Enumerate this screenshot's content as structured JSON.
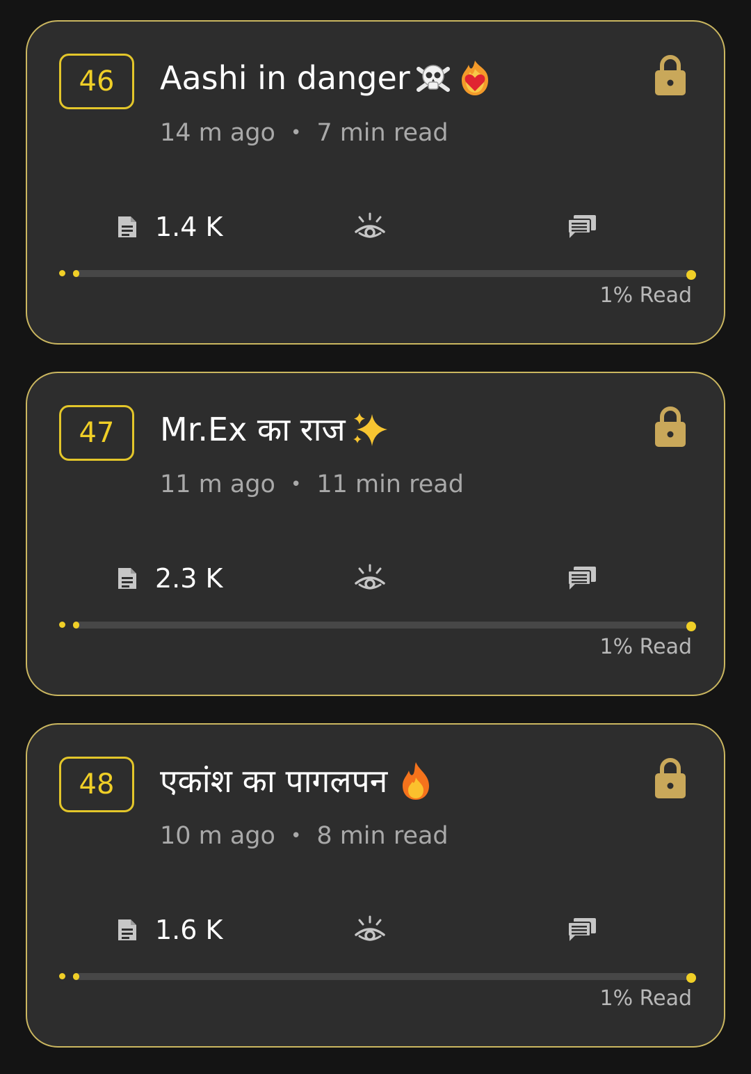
{
  "theme": {
    "background": "#141414",
    "card_background": "#2d2d2d",
    "card_border": "#cbb760",
    "accent": "#f0cf27",
    "lock_color": "#c9a85a",
    "icon_color": "#c6c6c6",
    "muted_text": "#a9a9a9"
  },
  "episodes": [
    {
      "number": "46",
      "title": "Aashi in danger",
      "title_emojis": [
        "skull-and-crossbones-icon",
        "heart-on-fire-icon"
      ],
      "time_ago": "14 m ago",
      "separator": "•",
      "read_time": "7 min read",
      "word_count": "1.4 K",
      "locked": true,
      "progress_percent": 1,
      "progress_label": "1% Read"
    },
    {
      "number": "47",
      "title": "Mr.Ex का राज",
      "title_emojis": [
        "sparkles-icon"
      ],
      "time_ago": "11 m ago",
      "separator": "•",
      "read_time": "11 min read",
      "word_count": "2.3 K",
      "locked": true,
      "progress_percent": 1,
      "progress_label": "1% Read"
    },
    {
      "number": "48",
      "title": "एकांश का पागलपन",
      "title_emojis": [
        "fire-icon"
      ],
      "time_ago": "10 m ago",
      "separator": "•",
      "read_time": "8 min read",
      "word_count": "1.6 K",
      "locked": true,
      "progress_percent": 1,
      "progress_label": "1% Read"
    }
  ]
}
